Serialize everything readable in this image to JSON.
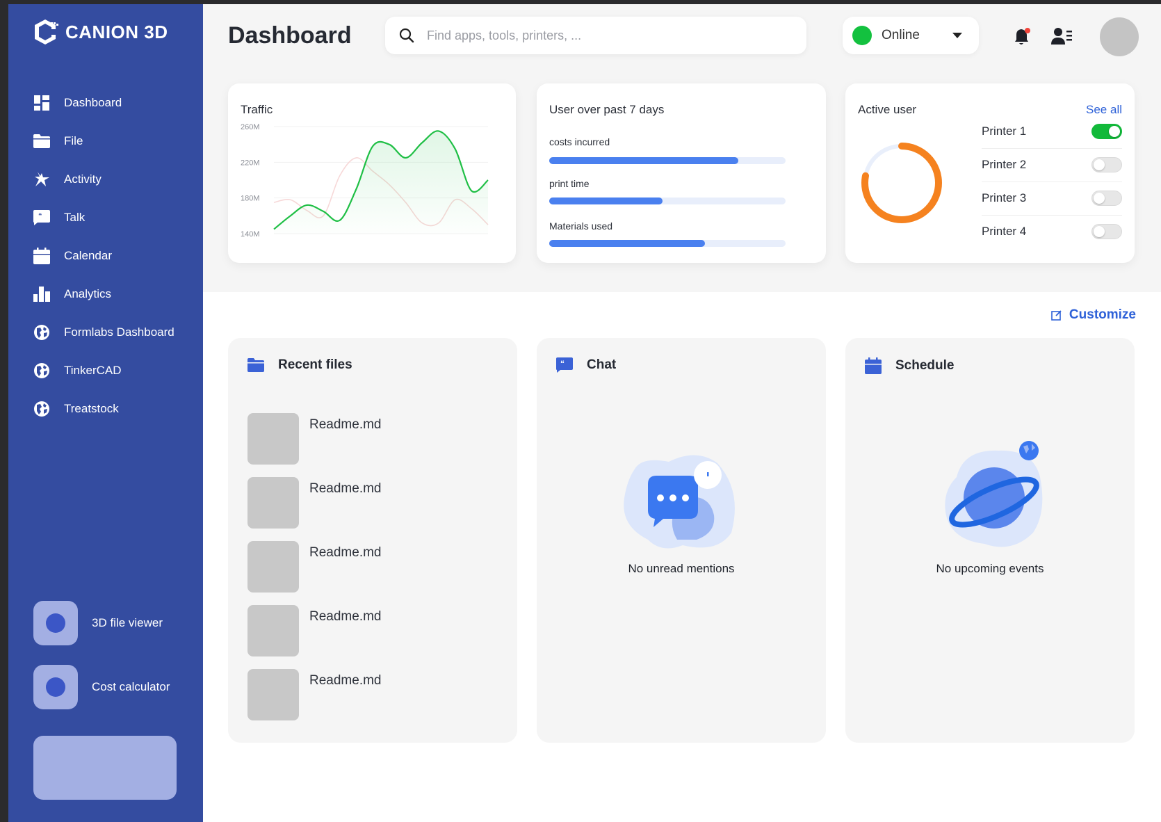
{
  "brand": {
    "name": "CANION 3D"
  },
  "sidebar": {
    "items": [
      {
        "label": "Dashboard",
        "icon": "dashboard-grid-icon"
      },
      {
        "label": "File",
        "icon": "folder-icon"
      },
      {
        "label": "Activity",
        "icon": "star-burst-icon"
      },
      {
        "label": "Talk",
        "icon": "chat-quote-icon"
      },
      {
        "label": "Calendar",
        "icon": "calendar-icon"
      },
      {
        "label": "Analytics",
        "icon": "bar-chart-icon"
      },
      {
        "label": "Formlabs Dashboard",
        "icon": "globe-icon"
      },
      {
        "label": "TinkerCAD",
        "icon": "globe-icon"
      },
      {
        "label": "Treatstock",
        "icon": "globe-icon"
      }
    ],
    "tools": [
      {
        "label": "3D file viewer"
      },
      {
        "label": "Cost calculator"
      }
    ]
  },
  "header": {
    "title": "Dashboard",
    "search_placeholder": "Find apps, tools, printers, ...",
    "status": {
      "label": "Online",
      "color": "#13c13f"
    },
    "notification_badge_color": "#f0433a"
  },
  "traffic": {
    "title": "Traffic",
    "chart_data": {
      "type": "line",
      "title": "Traffic",
      "y_ticks": [
        "260M",
        "220M",
        "180M",
        "140M"
      ],
      "ylim": [
        140,
        260
      ],
      "series": [
        {
          "values": [
            145,
            160,
            172,
            165,
            155,
            190,
            238,
            240,
            225,
            242,
            255,
            235,
            188,
            200
          ],
          "color": "#1fbf45"
        },
        {
          "values": [
            175,
            178,
            166,
            160,
            205,
            225,
            210,
            195,
            175,
            152,
            152,
            178,
            168,
            150
          ],
          "color": "#f7d8d8"
        }
      ]
    }
  },
  "usage": {
    "title": "User over past 7 days",
    "bars": [
      {
        "label": "costs incurred",
        "value": 0.8
      },
      {
        "label": "print time",
        "value": 0.48
      },
      {
        "label": "Materials used",
        "value": 0.66
      }
    ]
  },
  "active_user": {
    "title": "Active user",
    "see_all": "See all",
    "ring_fraction": 0.78,
    "ring_color": "#f5821f",
    "printers": [
      {
        "label": "Printer 1",
        "on": true
      },
      {
        "label": "Printer 2",
        "on": false
      },
      {
        "label": "Printer 3",
        "on": false
      },
      {
        "label": "Printer 4",
        "on": false
      }
    ]
  },
  "customize_label": "Customize",
  "recent_files": {
    "title": "Recent files",
    "files": [
      "Readme.md",
      "Readme.md",
      "Readme.md",
      "Readme.md",
      "Readme.md"
    ]
  },
  "chat": {
    "title": "Chat",
    "empty": "No unread mentions"
  },
  "schedule": {
    "title": "Schedule",
    "empty": "No upcoming events"
  }
}
